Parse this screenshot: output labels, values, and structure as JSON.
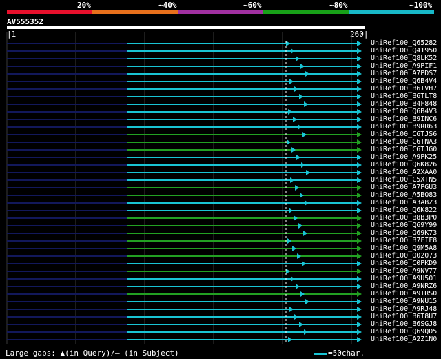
{
  "legend": {
    "labels": [
      "20%",
      "~40%",
      "~60%",
      "~80%",
      "~100%"
    ],
    "colors": [
      "#e8102c",
      "#e8701c",
      "#a030a0",
      "#18a018",
      "#18b8c8"
    ]
  },
  "query": {
    "id": "AV555352",
    "start_label": "1",
    "end_label": "260"
  },
  "footer": {
    "gaps_text": "Large gaps: ▲(in Query)/‒ (in Subject)",
    "scale_text": "=50char."
  },
  "colors": {
    "cyan": "#19c4d4",
    "green": "#22a022",
    "navy": "#12185a",
    "grid": "#3a3a3a"
  },
  "subjects": [
    {
      "name": "UniRef100_Q65282",
      "color": "cyan",
      "marker": "arrow"
    },
    {
      "name": "UniRef100_Q41950",
      "color": "cyan",
      "marker": "arrow"
    },
    {
      "name": "UniRef100_Q8LK52",
      "color": "cyan",
      "marker": "arrow"
    },
    {
      "name": "UniRef100_A9PIF1",
      "color": "cyan",
      "marker": "arrow"
    },
    {
      "name": "UniRef100_A7PDS7",
      "color": "cyan",
      "marker": "arrow"
    },
    {
      "name": "UniRef100_Q6B4V4",
      "color": "cyan",
      "marker": "arrow"
    },
    {
      "name": "UniRef100_B6TVH7",
      "color": "cyan",
      "marker": "arrow"
    },
    {
      "name": "UniRef100_B6TLT8",
      "color": "cyan",
      "marker": "arrow"
    },
    {
      "name": "UniRef100_B4F848",
      "color": "cyan",
      "marker": "arrow"
    },
    {
      "name": "UniRef100_Q6B4V3",
      "color": "cyan",
      "marker": "arrow"
    },
    {
      "name": "UniRef100_B9INC6",
      "color": "cyan",
      "marker": "arrow"
    },
    {
      "name": "UniRef100_B9RR63",
      "color": "cyan",
      "marker": "arrow"
    },
    {
      "name": "UniRef100_C6TJS6",
      "color": "green",
      "marker": "arrow"
    },
    {
      "name": "UniRef100_C6TNA3",
      "color": "green",
      "marker": "arrow"
    },
    {
      "name": "UniRef100_C6TJG0",
      "color": "green",
      "marker": "arrow"
    },
    {
      "name": "UniRef100_A9PK25",
      "color": "cyan",
      "marker": "arrow"
    },
    {
      "name": "UniRef100_Q6K826",
      "color": "cyan",
      "marker": "arrow"
    },
    {
      "name": "UniRef100_A2XAA0",
      "color": "cyan",
      "marker": "arrow"
    },
    {
      "name": "UniRef100_C5XTN5",
      "color": "cyan",
      "marker": "arrow"
    },
    {
      "name": "UniRef100_A7PGU3",
      "color": "green",
      "marker": "arrow"
    },
    {
      "name": "UniRef100_A5BQ83",
      "color": "green",
      "marker": "arrow"
    },
    {
      "name": "UniRef100_A3ABZ3",
      "color": "cyan",
      "marker": "arrow"
    },
    {
      "name": "UniRef100_Q6K822",
      "color": "cyan",
      "marker": "arrow"
    },
    {
      "name": "UniRef100_B8B3P0",
      "color": "green",
      "marker": "arrow"
    },
    {
      "name": "UniRef100_Q69Y99",
      "color": "green",
      "marker": "arrow"
    },
    {
      "name": "UniRef100_Q69K73",
      "color": "green",
      "marker": "arrow"
    },
    {
      "name": "UniRef100_B7FIF8",
      "color": "green",
      "marker": "arrow"
    },
    {
      "name": "UniRef100_Q9M5A8",
      "color": "green",
      "marker": "arrow"
    },
    {
      "name": "UniRef100_O02073",
      "color": "green",
      "marker": "arrow"
    },
    {
      "name": "UniRef100_C0PKD9",
      "color": "cyan",
      "marker": "arrow"
    },
    {
      "name": "UniRef100_A9NV77",
      "color": "green",
      "marker": "arrow"
    },
    {
      "name": "UniRef100_A9U501",
      "color": "cyan",
      "marker": "arrow"
    },
    {
      "name": "UniRef100_A9NRZ6",
      "color": "cyan",
      "marker": "arrow"
    },
    {
      "name": "UniRef100_A9TRS0",
      "color": "green",
      "marker": "arrow"
    },
    {
      "name": "UniRef100_A9NU15",
      "color": "cyan",
      "marker": "arrow"
    },
    {
      "name": "UniRef100_A9RJ48",
      "color": "cyan",
      "marker": "arrow"
    },
    {
      "name": "UniRef100_B6T8U7",
      "color": "cyan",
      "marker": "arrow"
    },
    {
      "name": "UniRef100_B6SGJ8",
      "color": "cyan",
      "marker": "arrow"
    },
    {
      "name": "UniRef100_Q69QD5",
      "color": "cyan",
      "marker": "arrow"
    },
    {
      "name": "UniRef100_A2Z1N0",
      "color": "cyan",
      "marker": "arrow"
    }
  ]
}
